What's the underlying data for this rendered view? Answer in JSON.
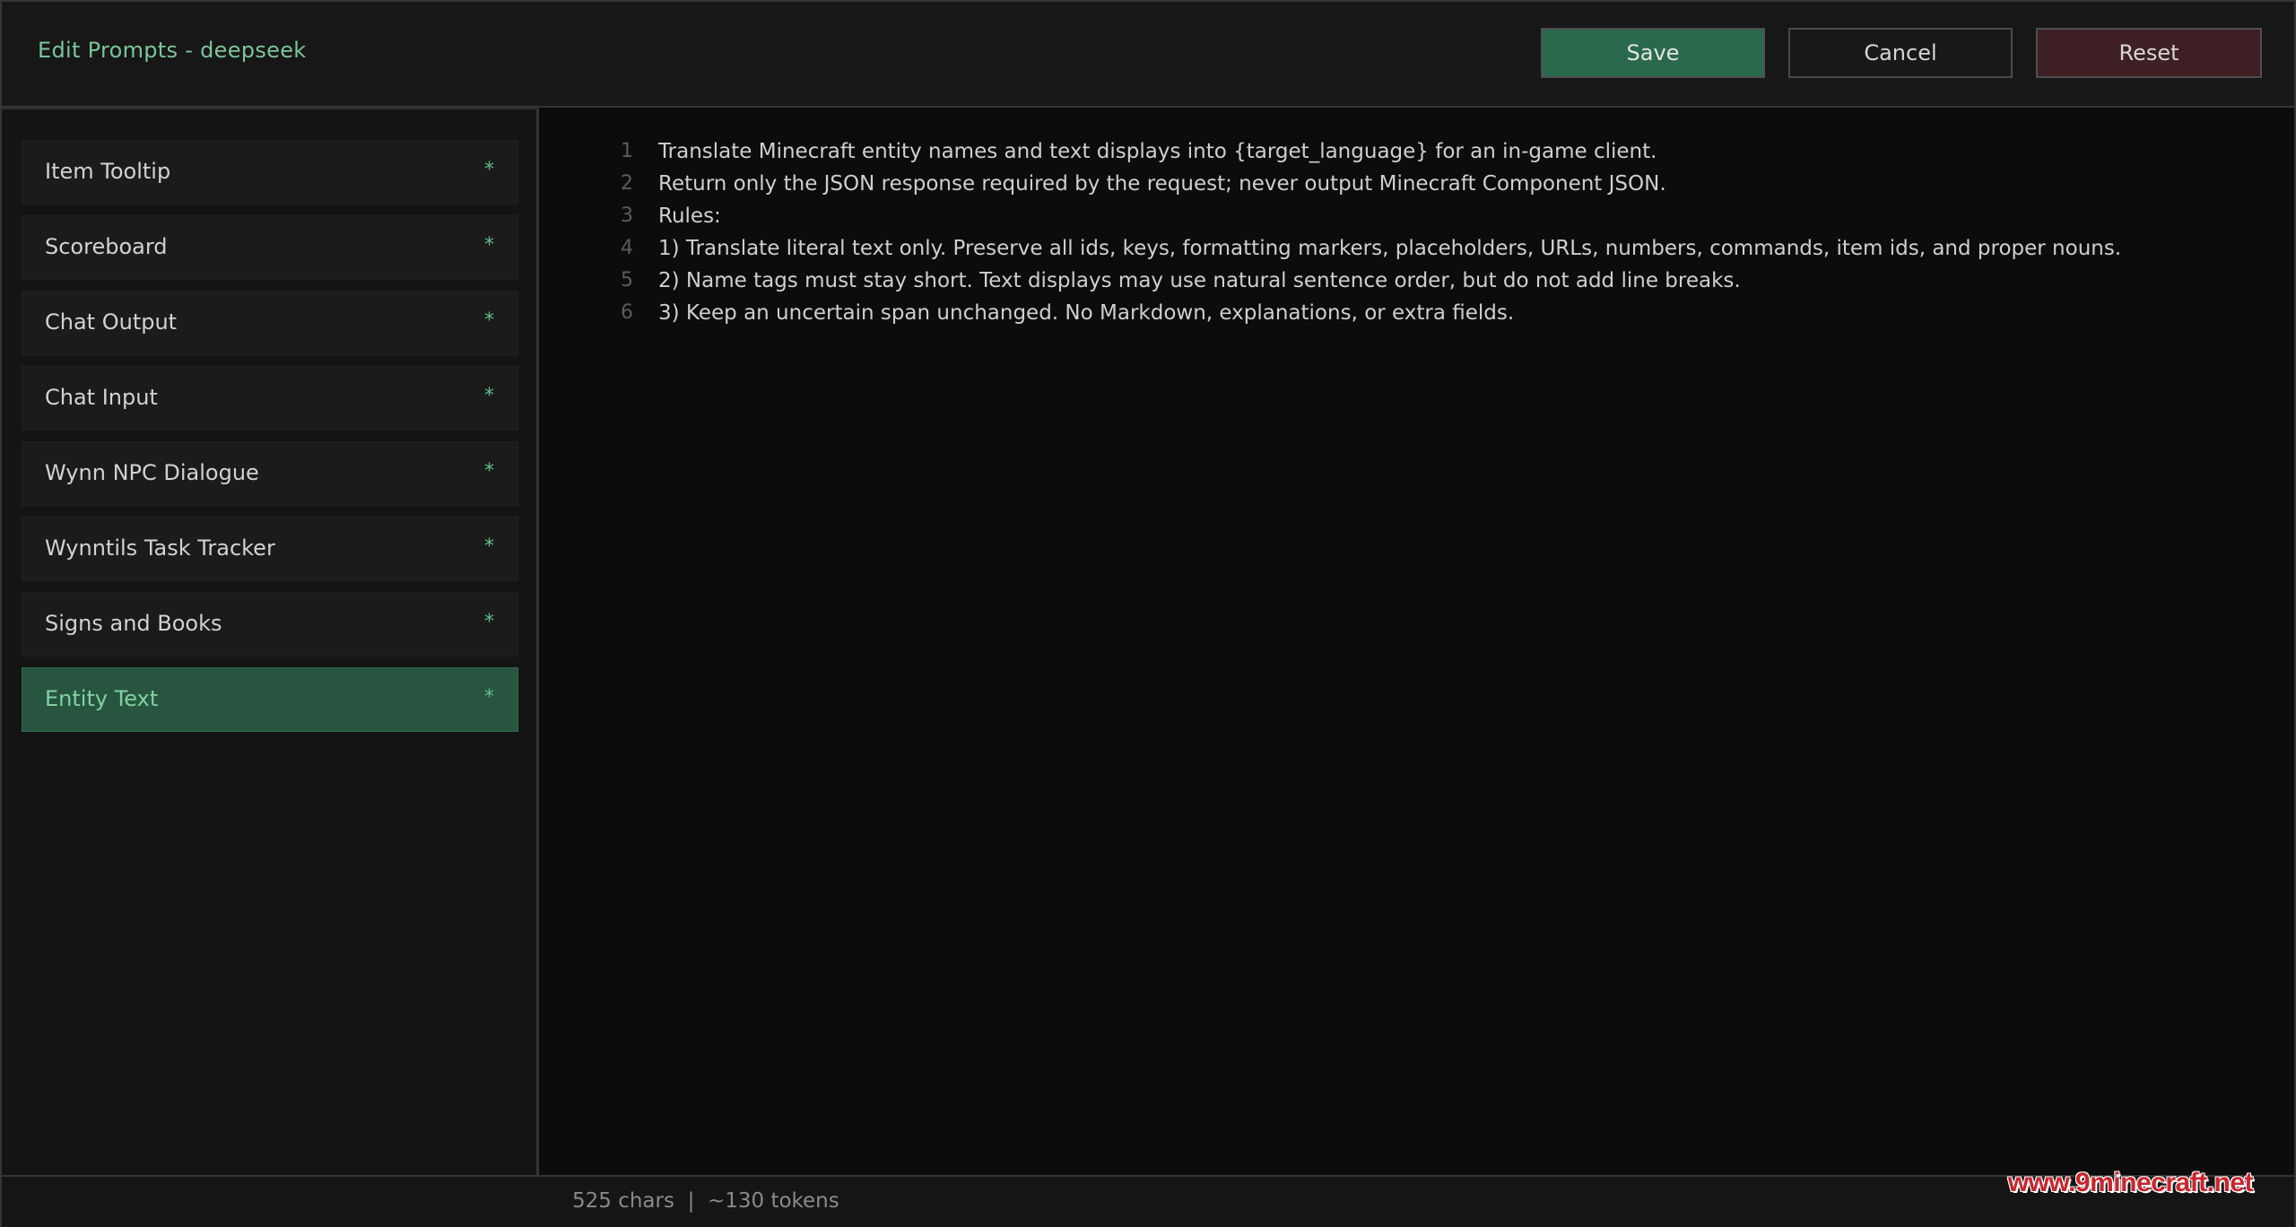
{
  "header": {
    "title": "Edit Prompts - deepseek",
    "buttons": {
      "save": "Save",
      "cancel": "Cancel",
      "reset": "Reset"
    }
  },
  "sidebar": {
    "items": [
      {
        "label": "Item Tooltip",
        "mark": "*"
      },
      {
        "label": "Scoreboard",
        "mark": "*"
      },
      {
        "label": "Chat Output",
        "mark": "*"
      },
      {
        "label": "Chat Input",
        "mark": "*"
      },
      {
        "label": "Wynn NPC Dialogue",
        "mark": "*"
      },
      {
        "label": "Wynntils Task Tracker",
        "mark": "*"
      },
      {
        "label": "Signs and Books",
        "mark": "*"
      },
      {
        "label": "Entity Text",
        "mark": "*"
      }
    ],
    "active_index": 7
  },
  "editor": {
    "lines": [
      {
        "num": "1",
        "text": "Translate Minecraft entity names and text displays into {target_language} for an in-game client."
      },
      {
        "num": "2",
        "text": "Return only the JSON response required by the request; never output Minecraft Component JSON."
      },
      {
        "num": "3",
        "text": "Rules:"
      },
      {
        "num": "4",
        "text": "1) Translate literal text only. Preserve all ids, keys, formatting markers, placeholders, URLs, numbers, commands, item ids, and proper nouns."
      },
      {
        "num": "5",
        "text": "2) Name tags must stay short. Text displays may use natural sentence order, but do not add line breaks."
      },
      {
        "num": "6",
        "text": "3) Keep an uncertain span unchanged. No Markdown, explanations, or extra fields."
      }
    ]
  },
  "status": {
    "text": "525 chars  |  ~130 tokens"
  },
  "watermark": "www.9minecraft.net",
  "colors": {
    "accent_green": "#2a6a4c",
    "reset_red": "#3e2024",
    "title_green": "#7cc49a"
  }
}
